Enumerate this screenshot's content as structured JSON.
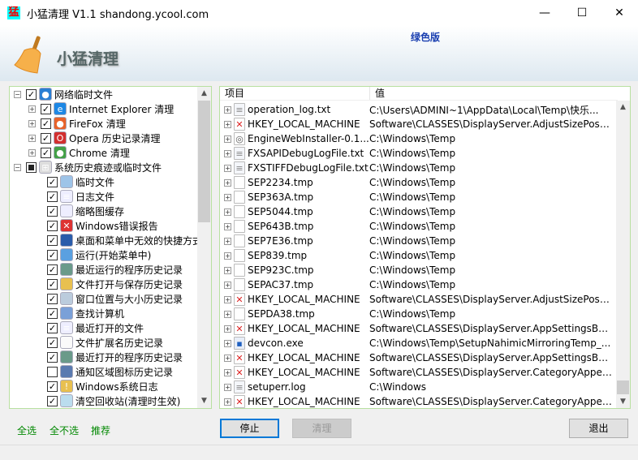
{
  "window": {
    "icon_char": "猛",
    "title": "小猛清理 V1.1 shandong.ycool.com",
    "minimize": "—",
    "maximize": "☐",
    "close": "✕"
  },
  "header": {
    "app_title": "小猛清理",
    "edition": "绿色版"
  },
  "tree": [
    {
      "level": 0,
      "expander": "−",
      "check": "checked",
      "icon": "globe-icon",
      "label": "网络临时文件"
    },
    {
      "level": 1,
      "expander": "+",
      "check": "checked",
      "icon": "ie-icon",
      "label": "Internet Explorer 清理"
    },
    {
      "level": 1,
      "expander": "+",
      "check": "checked",
      "icon": "firefox-icon",
      "label": "FireFox 清理"
    },
    {
      "level": 1,
      "expander": "+",
      "check": "checked",
      "icon": "opera-icon",
      "label": "Opera 历史记录清理"
    },
    {
      "level": 1,
      "expander": "+",
      "check": "checked",
      "icon": "chrome-icon",
      "label": "Chrome 清理"
    },
    {
      "level": 0,
      "expander": "−",
      "check": "partial",
      "icon": "windows-icon",
      "label": "系统历史痕迹或临时文件"
    },
    {
      "level": 2,
      "check": "checked",
      "icon": "temp-files-icon",
      "label": "临时文件"
    },
    {
      "level": 2,
      "check": "checked",
      "icon": "log-file-icon",
      "label": "日志文件"
    },
    {
      "level": 2,
      "check": "checked",
      "icon": "thumbnail-icon",
      "label": "缩略图缓存"
    },
    {
      "level": 2,
      "check": "checked",
      "icon": "error-icon",
      "label": "Windows错误报告"
    },
    {
      "level": 2,
      "check": "checked",
      "icon": "desktop-icon",
      "label": "桌面和菜单中无效的快捷方式"
    },
    {
      "level": 2,
      "check": "checked",
      "icon": "run-icon",
      "label": "运行(开始菜单中)"
    },
    {
      "level": 2,
      "check": "checked",
      "icon": "program-icon",
      "label": "最近运行的程序历史记录"
    },
    {
      "level": 2,
      "check": "checked",
      "icon": "folder-icon",
      "label": "文件打开与保存历史记录"
    },
    {
      "level": 2,
      "check": "checked",
      "icon": "window-icon",
      "label": "窗口位置与大小历史记录"
    },
    {
      "level": 2,
      "check": "checked",
      "icon": "search-computer-icon",
      "label": "查找计算机"
    },
    {
      "level": 2,
      "check": "checked",
      "icon": "document-icon",
      "label": "最近打开的文件"
    },
    {
      "level": 2,
      "check": "checked",
      "icon": "blank-file-icon",
      "label": "文件扩展名历史记录"
    },
    {
      "level": 2,
      "check": "checked",
      "icon": "program-icon",
      "label": "最近打开的程序历史记录"
    },
    {
      "level": 2,
      "check": "unchecked",
      "icon": "tray-icon",
      "label": "通知区域图标历史记录"
    },
    {
      "level": 2,
      "check": "checked",
      "icon": "event-log-icon",
      "label": "Windows系统日志"
    },
    {
      "level": 2,
      "check": "checked",
      "icon": "recycle-bin-icon",
      "label": "清空回收站(清理时生效)"
    }
  ],
  "list": {
    "columns": [
      "项目",
      "值"
    ],
    "rows": [
      {
        "icon": "text-file-icon",
        "name": "operation_log.txt",
        "value": "C:\\Users\\ADMINI~1\\AppData\\Local\\Temp\\快乐..."
      },
      {
        "icon": "registry-error-icon",
        "name": "HKEY_LOCAL_MACHINE",
        "value": "Software\\CLASSES\\DisplayServer.AdjustSizePosExt"
      },
      {
        "icon": "installer-icon",
        "name": "EngineWebInstaller-0.1....",
        "value": "C:\\Windows\\Temp"
      },
      {
        "icon": "text-file-icon",
        "name": "FXSAPIDebugLogFile.txt",
        "value": "C:\\Windows\\Temp"
      },
      {
        "icon": "text-file-icon",
        "name": "FXSTIFFDebugLogFile.txt",
        "value": "C:\\Windows\\Temp"
      },
      {
        "icon": "blank-file-icon",
        "name": "SEP2234.tmp",
        "value": "C:\\Windows\\Temp"
      },
      {
        "icon": "blank-file-icon",
        "name": "SEP363A.tmp",
        "value": "C:\\Windows\\Temp"
      },
      {
        "icon": "blank-file-icon",
        "name": "SEP5044.tmp",
        "value": "C:\\Windows\\Temp"
      },
      {
        "icon": "blank-file-icon",
        "name": "SEP643B.tmp",
        "value": "C:\\Windows\\Temp"
      },
      {
        "icon": "blank-file-icon",
        "name": "SEP7E36.tmp",
        "value": "C:\\Windows\\Temp"
      },
      {
        "icon": "blank-file-icon",
        "name": "SEP839.tmp",
        "value": "C:\\Windows\\Temp"
      },
      {
        "icon": "blank-file-icon",
        "name": "SEP923C.tmp",
        "value": "C:\\Windows\\Temp"
      },
      {
        "icon": "blank-file-icon",
        "name": "SEPAC37.tmp",
        "value": "C:\\Windows\\Temp"
      },
      {
        "icon": "registry-error-icon",
        "name": "HKEY_LOCAL_MACHINE",
        "value": "Software\\CLASSES\\DisplayServer.AdjustSizePosEx..."
      },
      {
        "icon": "blank-file-icon",
        "name": "SEPDA38.tmp",
        "value": "C:\\Windows\\Temp"
      },
      {
        "icon": "registry-error-icon",
        "name": "HKEY_LOCAL_MACHINE",
        "value": "Software\\CLASSES\\DisplayServer.AppSettingsBasic"
      },
      {
        "icon": "exe-icon",
        "name": "devcon.exe",
        "value": "C:\\Windows\\Temp\\SetupNahimicMirroringTemp_..."
      },
      {
        "icon": "registry-error-icon",
        "name": "HKEY_LOCAL_MACHINE",
        "value": "Software\\CLASSES\\DisplayServer.AppSettingsBas..."
      },
      {
        "icon": "registry-error-icon",
        "name": "HKEY_LOCAL_MACHINE",
        "value": "Software\\CLASSES\\DisplayServer.CategoryAppea..."
      },
      {
        "icon": "text-file-icon",
        "name": "setuperr.log",
        "value": "C:\\Windows"
      },
      {
        "icon": "registry-error-icon",
        "name": "HKEY_LOCAL_MACHINE",
        "value": "Software\\CLASSES\\DisplayServer.CategoryAppea..."
      }
    ]
  },
  "links": {
    "select_all": "全选",
    "select_none": "全不选",
    "recommend": "推荐"
  },
  "buttons": {
    "stop": "停止",
    "clean": "清理",
    "exit": "退出"
  },
  "colors": {
    "link": "#008800",
    "edition": "#1a3fb0",
    "panel_border": "#b8e0a0",
    "focus": "#0078d7"
  }
}
